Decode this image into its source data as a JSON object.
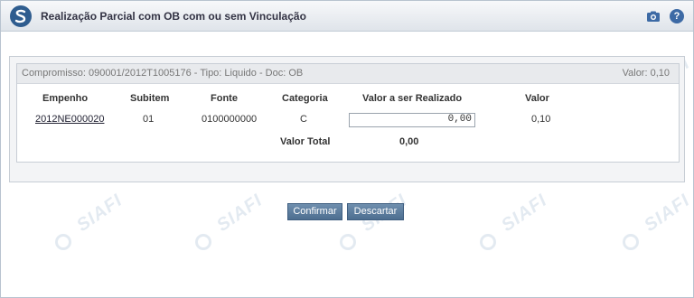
{
  "window": {
    "title": "Realização Parcial com OB com ou sem Vinculação"
  },
  "summary": {
    "compromisso": "Compromisso: 090001/2012T1005176 - Tipo: Liquido - Doc: OB",
    "valor": "Valor: 0,10"
  },
  "table": {
    "headers": [
      "Empenho",
      "Subitem",
      "Fonte",
      "Categoria",
      "Valor a ser Realizado",
      "Valor"
    ],
    "row": {
      "empenho": "2012NE000020",
      "subitem": "01",
      "fonte": "0100000000",
      "categoria": "C",
      "valor_realizar": "0,00",
      "valor": "0,10"
    },
    "total_label": "Valor Total",
    "total_value": "0,00"
  },
  "buttons": {
    "confirmar": "Confirmar",
    "descartar": "Descartar"
  },
  "icons": {
    "logo": "siafi-logo-icon",
    "camera": "camera-icon",
    "help": "help-icon",
    "help_glyph": "?"
  },
  "watermark": "SIAFI",
  "colors": {
    "header_bg": "#dfe4ea",
    "button_bg": "#5a7a9c",
    "logo_bg": "#2f5d8f"
  }
}
